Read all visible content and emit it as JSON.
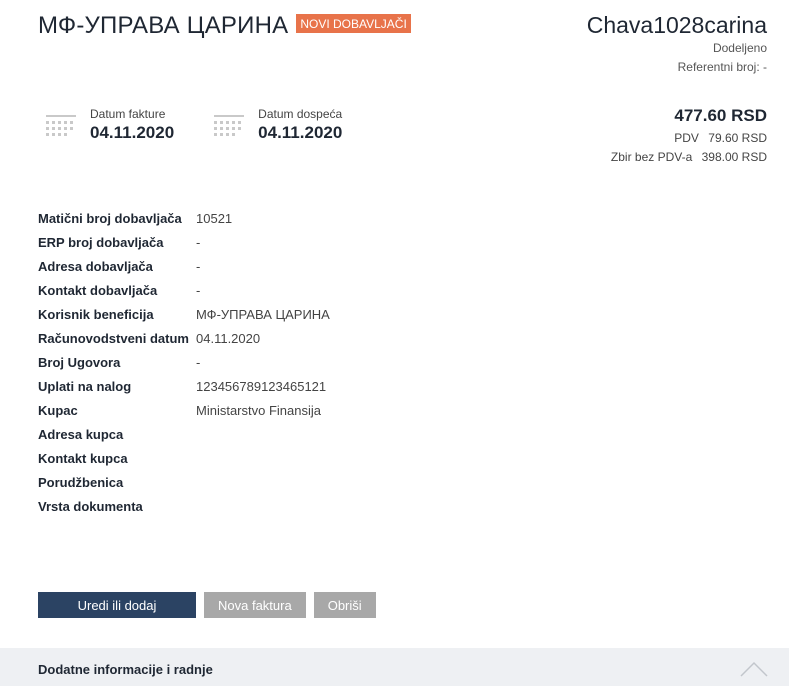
{
  "header": {
    "title": "МФ-УПРАВА ЦАРИНА",
    "badge": "NOVI DOBAVLJAČI",
    "company": "Chava1028carina",
    "status": "Dodeljeno",
    "reference": "Referentni broj: -"
  },
  "dates": [
    {
      "label": "Datum fakture",
      "value": "04.11.2020"
    },
    {
      "label": "Datum dospeća",
      "value": "04.11.2020"
    }
  ],
  "amounts": {
    "total": "477.60 RSD",
    "vat_label": "PDV",
    "vat_value": "79.60 RSD",
    "net_label": "Zbir bez PDV-a",
    "net_value": "398.00 RSD"
  },
  "details": [
    {
      "label": "Matični broj dobavljača",
      "value": "10521"
    },
    {
      "label": "ERP broj dobavljača",
      "value": "-"
    },
    {
      "label": "Adresa dobavljača",
      "value": "-"
    },
    {
      "label": "Kontakt dobavljača",
      "value": "-"
    },
    {
      "label": "Korisnik beneficija",
      "value": "МФ-УПРАВА ЦАРИНА"
    },
    {
      "label": "Računovodstveni datum",
      "value": "04.11.2020"
    },
    {
      "label": "Broj Ugovora",
      "value": "-"
    },
    {
      "label": "Uplati na nalog",
      "value": "123456789123465121"
    },
    {
      "label": "Kupac",
      "value": "Ministarstvo Finansija"
    },
    {
      "label": "Adresa kupca",
      "value": ""
    },
    {
      "label": "Kontakt kupca",
      "value": ""
    },
    {
      "label": "Porudžbenica",
      "value": ""
    },
    {
      "label": "Vrsta dokumenta",
      "value": ""
    }
  ],
  "actions": {
    "edit": "Uredi ili dodaj",
    "new_invoice": "Nova faktura",
    "delete": "Obriši"
  },
  "footer": {
    "label": "Dodatne informacije i radnje"
  },
  "colors": {
    "badge": "#e8734a",
    "primary_button": "#2b4363",
    "secondary_button": "#a8a8a8",
    "footer_bg": "#eef0f3"
  },
  "icons": [
    "calendar-icon",
    "chevron-up-icon"
  ]
}
